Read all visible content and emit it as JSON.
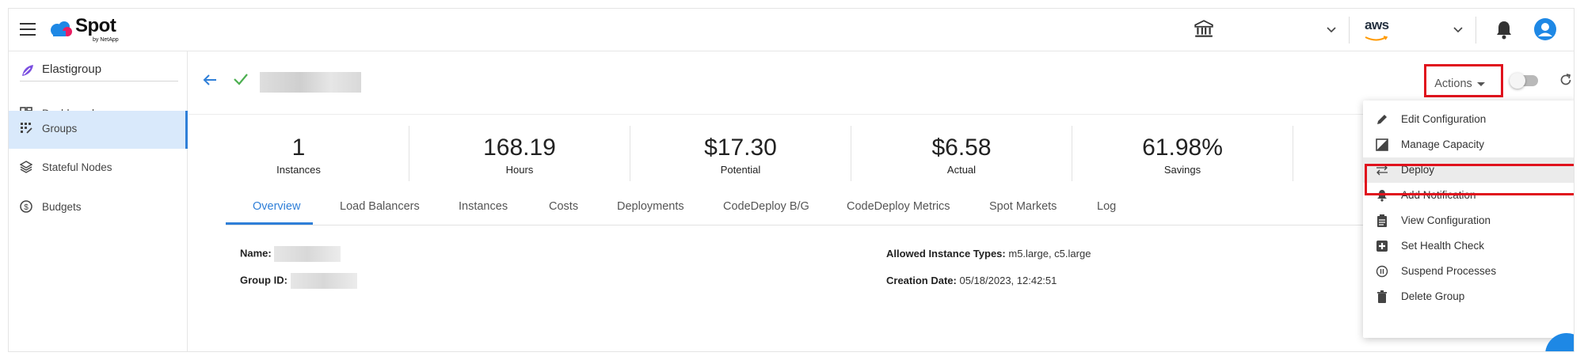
{
  "colors": {
    "accent": "#2f7fd8",
    "highlight": "#e0121d",
    "avatar": "#1e88e5",
    "active_bg": "#d9e9fb"
  },
  "topbar": {
    "logo_text": "Spot",
    "logo_sub": "by NetApp",
    "account_icon": "bank-icon",
    "cloud_provider": "aws"
  },
  "sidebar": {
    "section_title": "Elastigroup",
    "items": [
      {
        "label": "Dashboard",
        "icon": "dashboard-icon"
      },
      {
        "label": "Groups",
        "icon": "groups-icon",
        "active": true
      },
      {
        "label": "Stateful Nodes",
        "icon": "layers-icon"
      },
      {
        "label": "Budgets",
        "icon": "dollar-circle-icon"
      }
    ]
  },
  "header": {
    "status": "check-icon",
    "actions_label": "Actions"
  },
  "stats": [
    {
      "value": "1",
      "label": "Instances"
    },
    {
      "value": "168.19",
      "label": "Hours"
    },
    {
      "value": "$17.30",
      "label": "Potential"
    },
    {
      "value": "$6.58",
      "label": "Actual"
    },
    {
      "value": "61.98%",
      "label": "Savings"
    }
  ],
  "tabs": [
    {
      "label": "Overview",
      "active": true
    },
    {
      "label": "Load Balancers"
    },
    {
      "label": "Instances"
    },
    {
      "label": "Costs"
    },
    {
      "label": "Deployments"
    },
    {
      "label": "CodeDeploy B/G"
    },
    {
      "label": "CodeDeploy Metrics"
    },
    {
      "label": "Spot Markets"
    },
    {
      "label": "Log"
    }
  ],
  "details": {
    "name_label": "Name:",
    "group_id_label": "Group ID:",
    "instance_types_label": "Allowed Instance Types:",
    "instance_types_value": "m5.large, c5.large",
    "creation_date_label": "Creation Date:",
    "creation_date_value": "05/18/2023, 12:42:51"
  },
  "actions_menu": [
    {
      "label": "Edit Configuration",
      "icon": "pencil-icon"
    },
    {
      "label": "Manage Capacity",
      "icon": "capacity-icon"
    },
    {
      "label": "Deploy",
      "icon": "swap-arrows-icon",
      "hovered": true
    },
    {
      "label": "Add Notification",
      "icon": "bell-icon"
    },
    {
      "label": "View Configuration",
      "icon": "clipboard-icon"
    },
    {
      "label": "Set Health Check",
      "icon": "plus-box-icon"
    },
    {
      "label": "Suspend Processes",
      "icon": "pause-circle-icon"
    },
    {
      "label": "Delete Group",
      "icon": "trash-icon"
    }
  ]
}
